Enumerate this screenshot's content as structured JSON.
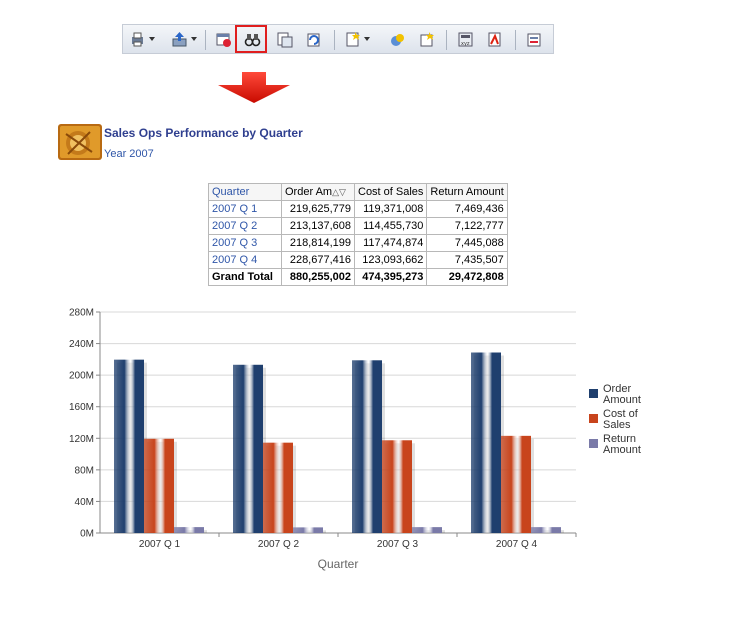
{
  "report": {
    "title": "Sales Ops Performance by Quarter",
    "subtitle": "Year 2007"
  },
  "toolbar": {
    "items": [
      {
        "icon": "print-icon",
        "dropdown": true
      },
      {
        "icon": "export-icon",
        "dropdown": true
      },
      {
        "icon": "schedule-icon",
        "dropdown": false
      },
      {
        "icon": "binoculars-icon",
        "dropdown": false,
        "highlighted": true
      },
      {
        "icon": "page-setup-icon",
        "dropdown": false
      },
      {
        "icon": "refresh-icon",
        "dropdown": false
      },
      {
        "icon": "new-analysis-icon",
        "dropdown": true
      },
      {
        "icon": "filter-icon",
        "dropdown": false
      },
      {
        "icon": "add-view-icon",
        "dropdown": false
      },
      {
        "icon": "calculator-icon",
        "dropdown": false
      },
      {
        "icon": "pdf-icon",
        "dropdown": false
      },
      {
        "icon": "properties-icon",
        "dropdown": false
      }
    ],
    "highlight_color": "#e01e1e"
  },
  "arrow": {
    "icon": "down-arrow-icon",
    "color": "#e01e1e"
  },
  "table": {
    "headers": [
      "Quarter",
      "Order Am",
      "Cost of Sales",
      "Return Amount"
    ],
    "rows": [
      {
        "quarter": "2007 Q 1",
        "order": "219,625,779",
        "cost": "119,371,008",
        "ret": "7,469,436"
      },
      {
        "quarter": "2007 Q 2",
        "order": "213,137,608",
        "cost": "114,455,730",
        "ret": "7,122,777"
      },
      {
        "quarter": "2007 Q 3",
        "order": "218,814,199",
        "cost": "117,474,874",
        "ret": "7,445,088"
      },
      {
        "quarter": "2007 Q 4",
        "order": "228,677,416",
        "cost": "123,093,662",
        "ret": "7,435,507"
      }
    ],
    "total": {
      "label": "Grand Total",
      "order": "880,255,002",
      "cost": "474,395,273",
      "ret": "29,472,808"
    }
  },
  "chart_data": {
    "type": "bar",
    "categories": [
      "2007 Q 1",
      "2007 Q 2",
      "2007 Q 3",
      "2007 Q 4"
    ],
    "series": [
      {
        "name": "Order Amount",
        "legend_lines": [
          "Order",
          "Amount"
        ],
        "values": [
          219625779,
          213137608,
          218814199,
          228677416
        ],
        "color": "#1f3f6e"
      },
      {
        "name": "Cost of Sales",
        "legend_lines": [
          "Cost of",
          "Sales"
        ],
        "values": [
          119371008,
          114455730,
          117474874,
          123093662
        ],
        "color": "#c8441c"
      },
      {
        "name": "Return Amount",
        "legend_lines": [
          "Return",
          "Amount"
        ],
        "values": [
          7469436,
          7122777,
          7445088,
          7435507
        ],
        "color": "#7a7aa8"
      }
    ],
    "yticks": [
      "0M",
      "40M",
      "80M",
      "120M",
      "160M",
      "200M",
      "240M",
      "280M"
    ],
    "ylim": [
      0,
      280000000
    ],
    "xlabel": "Quarter",
    "grid": true,
    "legend_position": "right"
  }
}
